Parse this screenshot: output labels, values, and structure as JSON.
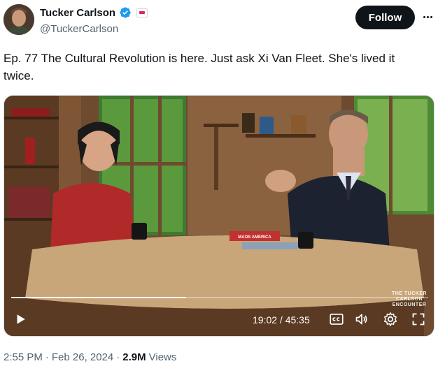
{
  "author": {
    "display_name": "Tucker Carlson",
    "handle": "@TuckerCarlson",
    "follow_label": "Follow"
  },
  "tweet": {
    "text": "Ep. 77  The Cultural Revolution is here. Just ask Xi Van Fleet. She's lived it twice."
  },
  "video": {
    "time_display": "19:02 / 45:35",
    "progress_fraction": 0.42,
    "watermark": "THE TUCKER CARLSON ENCOUNTER",
    "book_title": "MAOS AMERICA"
  },
  "meta": {
    "time": "2:55 PM",
    "date": "Feb 26, 2024",
    "views_count": "2.9M",
    "views_label": "Views",
    "separator": "·"
  },
  "colors": {
    "verified": "#1d9bf0",
    "follow_bg": "#0f1419",
    "secondary_text": "#536471"
  },
  "icons": [
    "verified-badge-icon",
    "more-icon",
    "play-icon",
    "captions-icon",
    "volume-icon",
    "settings-icon",
    "fullscreen-icon"
  ]
}
